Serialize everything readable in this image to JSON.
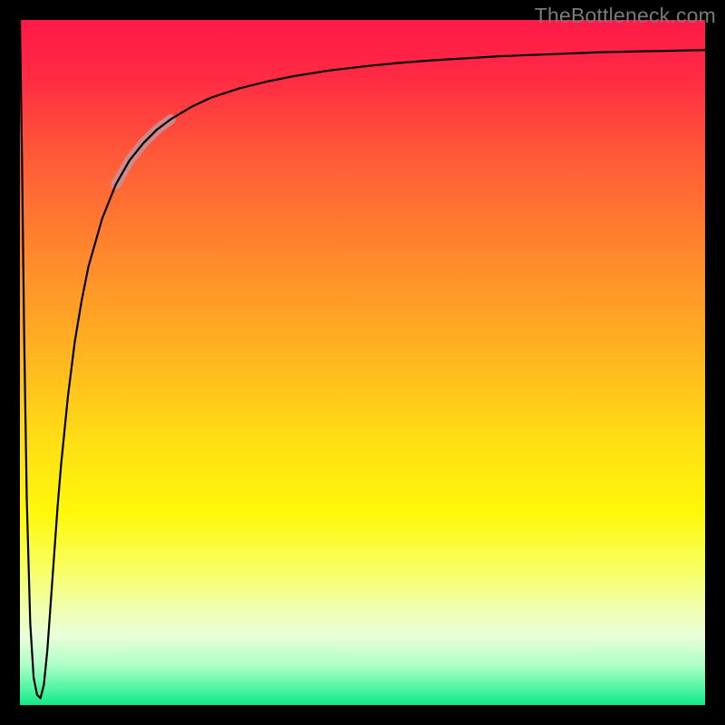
{
  "watermark": "TheBottleneck.com",
  "chart_data": {
    "type": "line",
    "title": "",
    "xlabel": "",
    "ylabel": "",
    "xlim": [
      0,
      100
    ],
    "ylim": [
      0,
      100
    ],
    "axes_visible": false,
    "grid": false,
    "background_gradient": {
      "stops": [
        {
          "offset": 0.0,
          "color": "#ff1a48"
        },
        {
          "offset": 0.08,
          "color": "#ff2a44"
        },
        {
          "offset": 0.2,
          "color": "#ff5a38"
        },
        {
          "offset": 0.35,
          "color": "#ff8a2c"
        },
        {
          "offset": 0.5,
          "color": "#ffb820"
        },
        {
          "offset": 0.62,
          "color": "#ffe014"
        },
        {
          "offset": 0.72,
          "color": "#fff80a"
        },
        {
          "offset": 0.8,
          "color": "#f8ff60"
        },
        {
          "offset": 0.86,
          "color": "#f0ffb0"
        },
        {
          "offset": 0.9,
          "color": "#e8ffd8"
        },
        {
          "offset": 0.94,
          "color": "#b0ffc8"
        },
        {
          "offset": 0.97,
          "color": "#60f8a8"
        },
        {
          "offset": 1.0,
          "color": "#10e888"
        }
      ]
    },
    "series": [
      {
        "name": "bottleneck-curve",
        "stroke": "#000000",
        "stroke_width": 2.2,
        "x": [
          0.0,
          0.3,
          0.6,
          1.0,
          1.5,
          2.0,
          2.5,
          3.0,
          3.5,
          4.0,
          4.5,
          5.0,
          5.5,
          6.0,
          7.0,
          8.0,
          9.0,
          10.0,
          12.0,
          14.0,
          16.0,
          18.0,
          20.0,
          22.0,
          25.0,
          28.0,
          32.0,
          36.0,
          40.0,
          45.0,
          50.0,
          55.0,
          60.0,
          65.0,
          70.0,
          75.0,
          80.0,
          85.0,
          90.0,
          95.0,
          100.0
        ],
        "y": [
          100.0,
          80.0,
          55.0,
          30.0,
          12.0,
          4.0,
          1.5,
          1.0,
          3.0,
          8.0,
          15.0,
          22.0,
          29.0,
          35.0,
          45.0,
          53.0,
          59.0,
          64.0,
          71.0,
          76.0,
          79.5,
          82.0,
          84.0,
          85.5,
          87.3,
          88.7,
          90.0,
          91.0,
          91.8,
          92.6,
          93.2,
          93.7,
          94.1,
          94.4,
          94.7,
          94.9,
          95.1,
          95.3,
          95.4,
          95.5,
          95.6
        ]
      },
      {
        "name": "highlight-segment",
        "stroke": "#c98f96",
        "stroke_width": 11,
        "opacity": 0.9,
        "x": [
          14.0,
          16.0,
          18.0,
          20.0,
          22.0
        ],
        "y": [
          76.0,
          79.5,
          82.0,
          84.0,
          85.5
        ]
      }
    ]
  }
}
